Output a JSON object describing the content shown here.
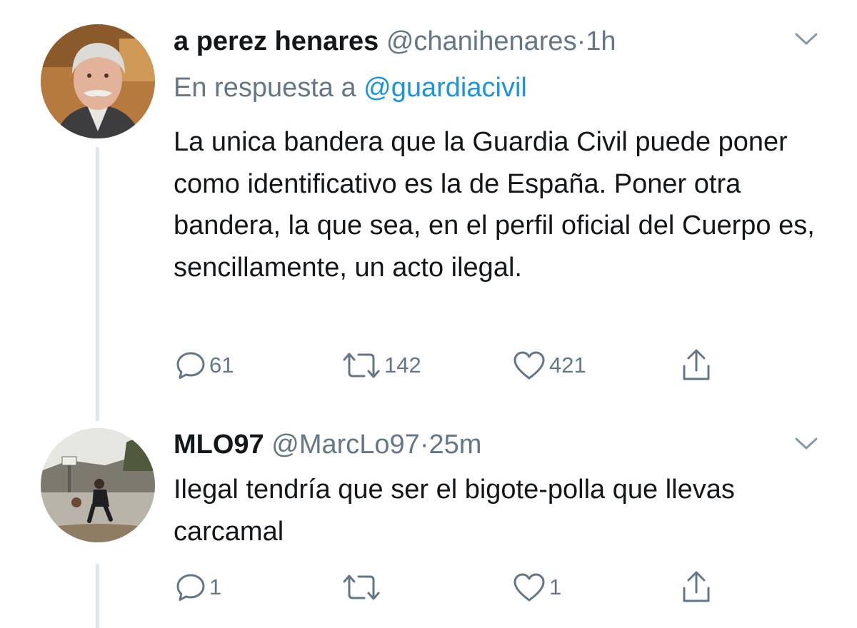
{
  "tweets": [
    {
      "display_name": "a  perez henares",
      "handle": "@chanihenares",
      "separator": "·",
      "time": "1h",
      "reply_prefix": "En respuesta a ",
      "reply_mention": "@guardiacivil",
      "text": "La unica bandera que la Guardia Civil puede poner como identificativo es la de España. Poner otra bandera, la que sea, en el perfil oficial del Cuerpo es, sencillamente, un acto ilegal.",
      "replies": "61",
      "retweets": "142",
      "likes": "421"
    },
    {
      "display_name": "MLO97",
      "handle": "@MarcLo97",
      "separator": "·",
      "time": "25m",
      "text": "Ilegal tendría que ser el bigote-polla que llevas carcamal",
      "replies": "1",
      "retweets": "",
      "likes": "1"
    }
  ],
  "icons": {
    "reply": "speech-bubble",
    "retweet": "retweet-arrows",
    "like": "heart-outline",
    "share": "upload-arrow",
    "menu": "chevron-down"
  },
  "colors": {
    "text": "#14171a",
    "secondary": "#657786",
    "link": "#1b95e0",
    "thread_line": "#e1e8ed"
  }
}
